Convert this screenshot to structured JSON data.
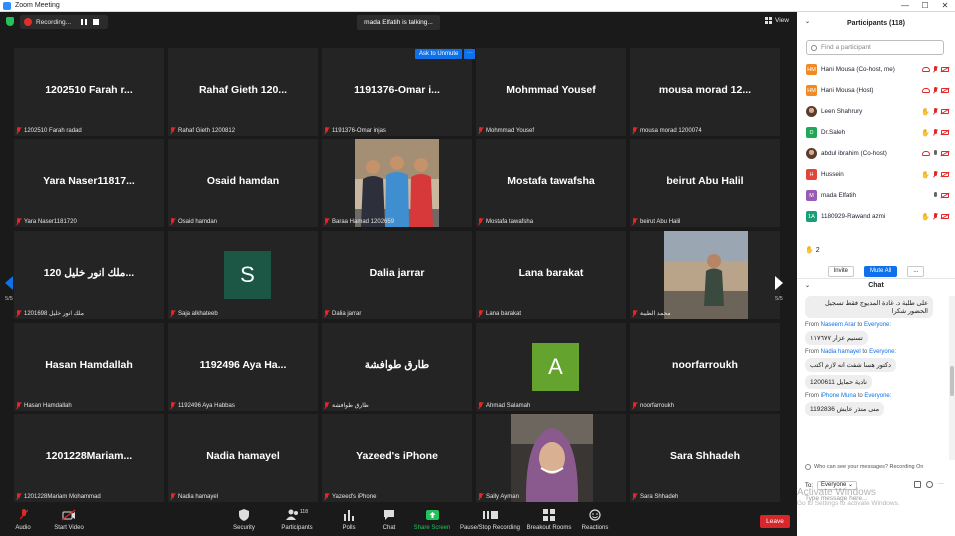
{
  "window": {
    "title": "Zoom Meeting",
    "controls": [
      "—",
      "☐",
      "✕"
    ]
  },
  "topbar": {
    "recording_label": "Recording...",
    "talking": "mada Elfatih is talking...",
    "view_label": "View"
  },
  "unmute": {
    "label": "Ask to Unmute",
    "more": "···"
  },
  "pager": {
    "left": "5/5",
    "right": "5/5"
  },
  "tiles": [
    {
      "big": "1202510 Farah r...",
      "foot": "1202510 Farah radad"
    },
    {
      "big": "Rahaf Gieth 120...",
      "foot": "Rahaf Gieth 1200812"
    },
    {
      "big": "1191376-Omar i...",
      "foot": "1191376-Omar injas"
    },
    {
      "big": "Mohmmad Yousef",
      "foot": "Mohmmad Yousef"
    },
    {
      "big": "mousa morad 12...",
      "foot": "mousa morad 1200074"
    },
    {
      "big": "Yara Naser11817...",
      "foot": "Yara Naser1181720"
    },
    {
      "big": "Osaid hamdan",
      "foot": "Osaid hamdan"
    },
    {
      "big": "",
      "foot": "Baraa Hamad 1202659"
    },
    {
      "big": "Mostafa tawafsha",
      "foot": "Mostafa tawafsha"
    },
    {
      "big": "beirut Abu Halil",
      "foot": "beirut Abu Halil"
    },
    {
      "big": "ملك انور خليل 120...",
      "foot": "ملك انور خليل 1201698"
    },
    {
      "big": "",
      "foot": "Saja alkhateeb",
      "avatar": "S",
      "avatar_color": "#1c5746"
    },
    {
      "big": "Dalia jarrar",
      "foot": "Dalia jarrar"
    },
    {
      "big": "Lana barakat",
      "foot": "Lana barakat"
    },
    {
      "big": "",
      "foot": "محمد الطيبة"
    },
    {
      "big": "Hasan Hamdallah",
      "foot": "Hasan Hamdallah"
    },
    {
      "big": "1192496 Aya Ha...",
      "foot": "1192496 Aya Habbas"
    },
    {
      "big": "طارق طوافشة",
      "foot": "طارق طوافشة"
    },
    {
      "big": "",
      "foot": "Ahmad Salamah",
      "avatar": "A",
      "avatar_color": "#65a32f"
    },
    {
      "big": "noorfarroukh",
      "foot": "noorfarroukh"
    },
    {
      "big": "1201228Mariam...",
      "foot": "1201228Mariam Mohammad"
    },
    {
      "big": "Nadia hamayel",
      "foot": "Nadia hamayel"
    },
    {
      "big": "Yazeed's iPhone",
      "foot": "Yazeed's iPhone"
    },
    {
      "big": "",
      "foot": "Sally Ayman"
    },
    {
      "big": "Sara Shhadeh",
      "foot": "Sara Shhadeh"
    }
  ],
  "toolbar": {
    "audio": "Audio",
    "video": "Start Video",
    "security": "Security",
    "participants": "Participants",
    "participants_count": "118",
    "polls": "Polls",
    "chat": "Chat",
    "share": "Share Screen",
    "record": "Pause/Stop Recording",
    "breakout": "Breakout Rooms",
    "reactions": "Reactions",
    "leave": "Leave"
  },
  "panel": {
    "title": "Participants (118)",
    "search_placeholder": "Find a participant",
    "participants": [
      {
        "initials": "HM",
        "color": "#f08a24",
        "name": "Hani Mousa (Co-host, me)"
      },
      {
        "initials": "HM",
        "color": "#f08a24",
        "name": "Hani Mousa (Host)"
      },
      {
        "initials": "",
        "color": "",
        "name": "Leen Shahrury"
      },
      {
        "initials": "D",
        "color": "#1fa855",
        "name": "Dr.Saleh"
      },
      {
        "initials": "",
        "color": "",
        "name": "abdul ibrahim (Co-host)"
      },
      {
        "initials": "H",
        "color": "#e0463a",
        "name": "Hussein"
      },
      {
        "initials": "M",
        "color": "#9b59b6",
        "name": "mada Elfatih"
      },
      {
        "initials": "1A",
        "color": "#1b9e77",
        "name": "1180929-Rawand azmi"
      }
    ],
    "hands_count": "2",
    "invite": "Invite",
    "mute_all": "Mute All",
    "more": "...",
    "chat_title": "Chat",
    "chat_messages": [
      {
        "text": "على طلبة د. غادة المديوج فقط تسجيل الحضور شكرا"
      },
      {
        "from_prefix": "From",
        "from": "Naseem Arar",
        "to_word": "to",
        "to": "Everyone:",
        "text": "تسنيم عزار ١١٧٦٧٧"
      },
      {
        "from_prefix": "From",
        "from": "Nadia hamayel",
        "to_word": "to",
        "to": "Everyone:",
        "text": "دكتور هسا شفت انه لازم اكتب"
      },
      {
        "text": "نادية حمايل 1200611"
      },
      {
        "from_prefix": "From",
        "from": "iPhone Muna",
        "to_word": "to",
        "to": "Everyone:",
        "text": "منى منذر عايش 1192836"
      }
    ],
    "who_can_see": "Who can see your messages? Recording On",
    "to_label": "To:",
    "to_value": "Everyone",
    "input_placeholder": "Type message here..."
  },
  "watermark": {
    "line1": "Activate Windows",
    "line2": "Go to Settings to activate Windows."
  }
}
